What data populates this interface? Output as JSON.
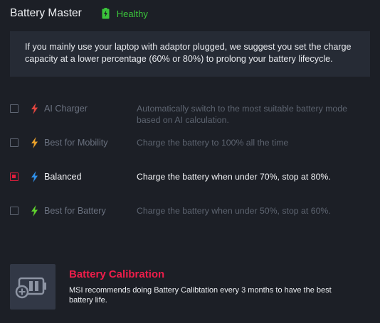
{
  "header": {
    "title": "Battery Master",
    "status_icon": "battery-charging-icon",
    "status": "Healthy",
    "status_color": "#3bc43b"
  },
  "notice": {
    "text": "If you mainly use your laptop with adaptor plugged, we suggest you set the charge capacity at a lower percentage (60% or 80%) to prolong your battery lifecycle."
  },
  "options": [
    {
      "label": "AI Charger",
      "description": "Automatically switch to the most suitable battery mode based on AI calculation.",
      "icon": "bolt-icon",
      "icon_color": "#e0453f",
      "checked": false
    },
    {
      "label": "Best for Mobility",
      "description": "Charge the battery to 100% all the time",
      "icon": "bolt-icon",
      "icon_color": "#e8a02a",
      "checked": false
    },
    {
      "label": "Balanced",
      "description": "Charge the battery when under 70%, stop at 80%.",
      "icon": "bolt-icon",
      "icon_color": "#2f8fe8",
      "checked": true
    },
    {
      "label": "Best for Battery",
      "description": "Charge the battery when under 50%, stop at 60%.",
      "icon": "bolt-icon",
      "icon_color": "#5fd12e",
      "checked": false
    }
  ],
  "calibration": {
    "icon": "battery-add-icon",
    "title": "Battery Calibration",
    "description": "MSI recommends doing Battery Calibtation every 3 months to have the best battery life.",
    "accent": "#ee1d4a"
  }
}
